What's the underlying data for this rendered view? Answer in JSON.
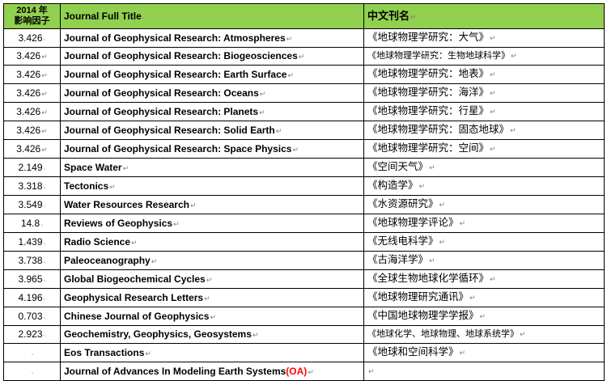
{
  "colors": {
    "header_bg": "#92d050",
    "border": "#000000",
    "oa_highlight": "#ff0000",
    "paragraph_mark": "#7f7f7f"
  },
  "header": {
    "factor_line1": "2014 年",
    "factor_line2": "影响因子",
    "title": "Journal Full Title",
    "chinese_title": "中文刊名",
    "title_mark": "˴",
    "chinese_mark": "↵"
  },
  "rows": [
    {
      "factor": "3.426",
      "factor_mark": "˴",
      "title": "Journal of Geophysical Research: Atmospheres",
      "title_mark": "↵",
      "chinese": "《地球物理学研究：大气》",
      "chinese_mark": "↵"
    },
    {
      "factor": "3.426",
      "factor_mark": "↵",
      "title": "Journal of Geophysical Research: Biogeosciences",
      "title_mark": "↵",
      "chinese": "《地球物理学研究：生物地球科学》",
      "chinese_mark": "↵"
    },
    {
      "factor": "3.426",
      "factor_mark": "↵",
      "title": "Journal of Geophysical Research: Earth Surface",
      "title_mark": "↵",
      "chinese": "《地球物理学研究：地表》",
      "chinese_mark": "↵"
    },
    {
      "factor": "3.426",
      "factor_mark": "↵",
      "title": "Journal of Geophysical Research: Oceans",
      "title_mark": "↵",
      "chinese": "《地球物理学研究：海洋》",
      "chinese_mark": "↵"
    },
    {
      "factor": "3.426",
      "factor_mark": "↵",
      "title": "Journal of Geophysical Research: Planets",
      "title_mark": "↵",
      "chinese": "《地球物理学研究：行星》",
      "chinese_mark": "↵"
    },
    {
      "factor": "3.426",
      "factor_mark": "↵",
      "title": "Journal of Geophysical Research: Solid Earth",
      "title_mark": "↵",
      "chinese": "《地球物理学研究：固态地球》",
      "chinese_mark": "↵"
    },
    {
      "factor": "3.426",
      "factor_mark": "↵",
      "title": "Journal of Geophysical Research: Space Physics",
      "title_mark": "↵",
      "chinese": "《地球物理学研究：空间》",
      "chinese_mark": "↵"
    },
    {
      "factor": "2.149",
      "factor_mark": "˴",
      "title": "Space Water",
      "title_mark": "↵",
      "chinese": "《空间天气》",
      "chinese_mark": "↵"
    },
    {
      "factor": "3.318",
      "factor_mark": "˴",
      "title": "Tectonics",
      "title_mark": "↵",
      "chinese": "《构造学》",
      "chinese_mark": "↵"
    },
    {
      "factor": "3.549",
      "factor_mark": "˴",
      "title": "Water Resources Research",
      "title_mark": "↵",
      "chinese": "《水资源研究》",
      "chinese_mark": "↵"
    },
    {
      "factor": "14.8",
      "factor_mark": "˴",
      "title": "Reviews of Geophysics",
      "title_mark": "↵",
      "chinese": "《地球物理学评论》",
      "chinese_mark": "↵"
    },
    {
      "factor": "1.439",
      "factor_mark": "˴",
      "title": "Radio Science",
      "title_mark": "↵",
      "chinese": "《无线电科学》",
      "chinese_mark": "↵"
    },
    {
      "factor": "3.738",
      "factor_mark": "˴",
      "title": "Paleoceanography",
      "title_mark": "↵",
      "chinese": "《古海洋学》",
      "chinese_mark": "↵"
    },
    {
      "factor": "3.965",
      "factor_mark": "˴",
      "title": "Global Biogeochemical Cycles",
      "title_mark": "↵",
      "chinese": "《全球生物地球化学循环》",
      "chinese_mark": "↵"
    },
    {
      "factor": "4.196",
      "factor_mark": "˴",
      "title": "Geophysical Research Letters",
      "title_mark": "↵",
      "chinese": "《地球物理研究通讯》",
      "chinese_mark": "↵"
    },
    {
      "factor": "0.703",
      "factor_mark": "˴",
      "title": "Chinese Journal of Geophysics",
      "title_mark": "↵",
      "chinese": "《中国地球物理学学报》",
      "chinese_mark": "↵"
    },
    {
      "factor": "2.923",
      "factor_mark": "˴",
      "title": "Geochemistry, Geophysics, Geosystems",
      "title_mark": "↵",
      "chinese": "《地球化学、地球物理、地球系统学》",
      "chinese_mark": "↵"
    },
    {
      "factor": "",
      "factor_mark": "˴",
      "title": "Eos Transactions",
      "title_mark": "↵",
      "chinese": "《地球和空间科学》",
      "chinese_mark": "↵"
    },
    {
      "factor": "",
      "factor_mark": "˴",
      "title": "Journal of Advances In Modeling Earth Systems",
      "title_suffix": "(OA)",
      "title_mark": "↵",
      "chinese": "",
      "chinese_mark": "↵"
    }
  ]
}
